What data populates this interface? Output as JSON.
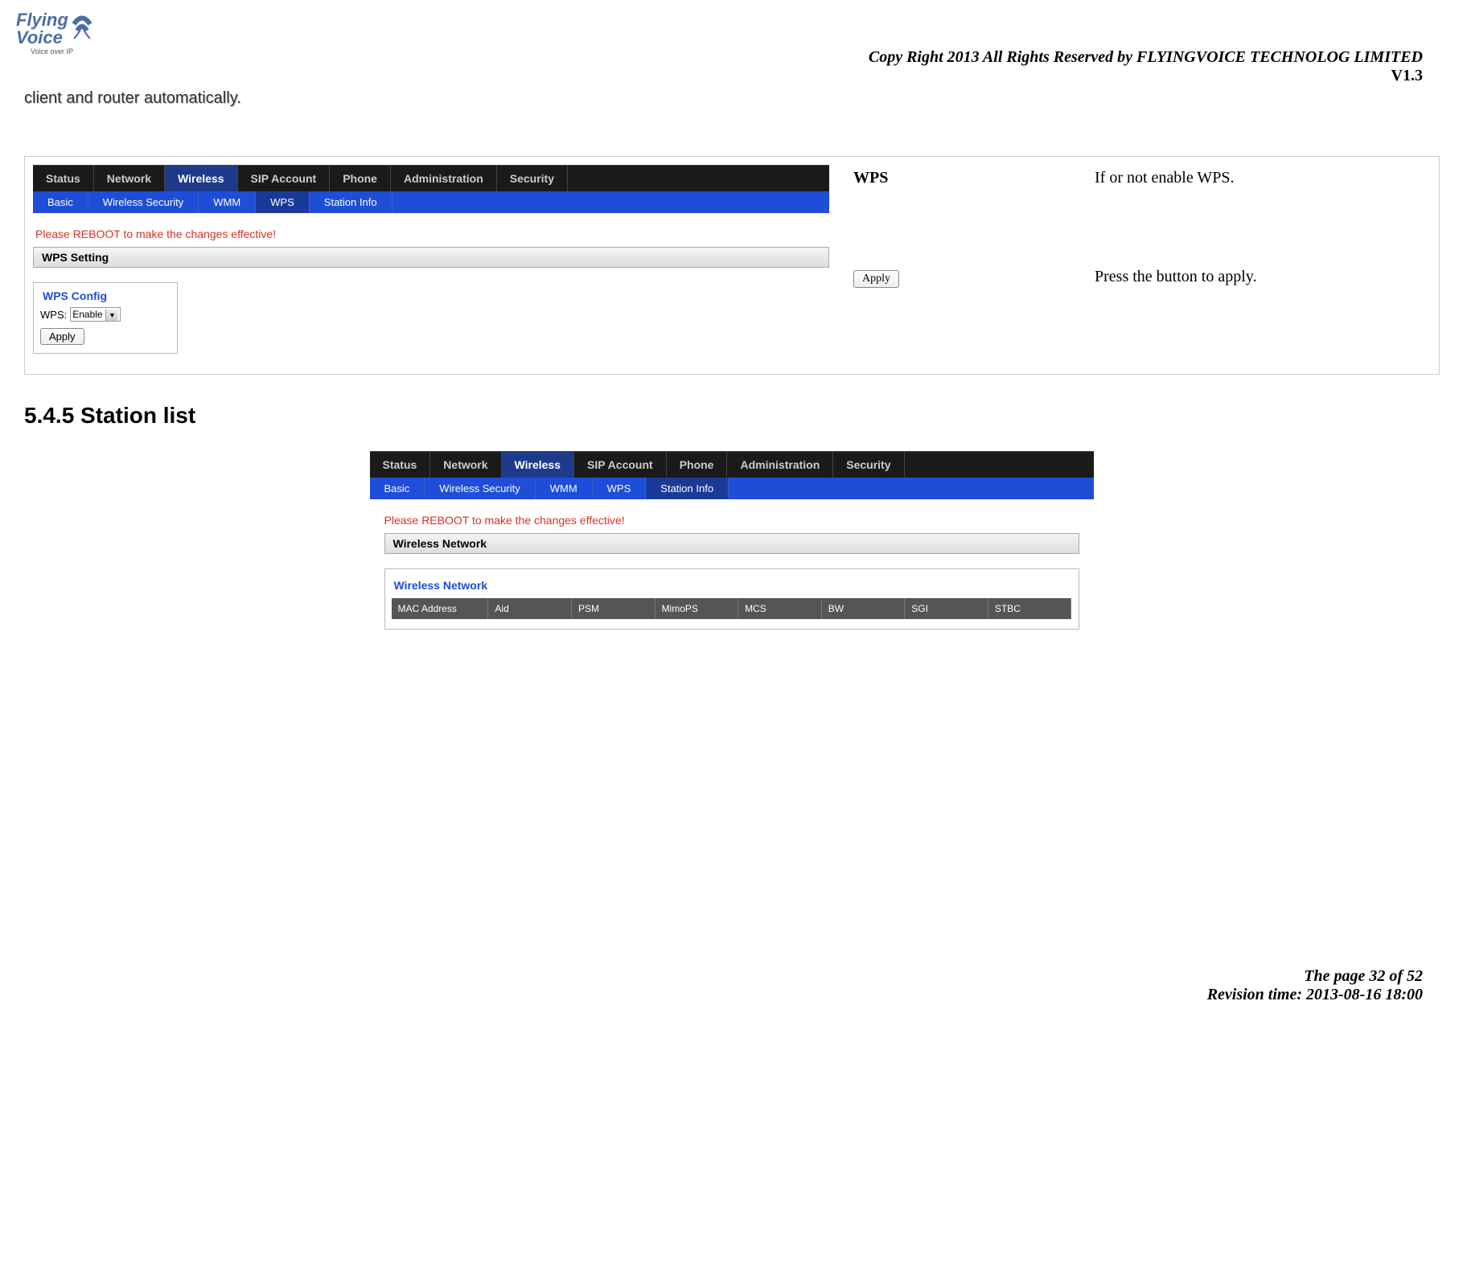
{
  "header": {
    "copyright": "Copy Right 2013 All Rights Reserved by FLYINGVOICE TECHNOLOG LIMITED",
    "version": "V1.3",
    "intro": "client and router automatically."
  },
  "logo": {
    "line1": "Flying",
    "line2": "Voice",
    "tagline": "Voice over IP"
  },
  "desc_table": {
    "row1_label": "WPS",
    "row1_text": "If or not enable WPS.",
    "row2_button": "Apply",
    "row2_text": "Press the button to apply."
  },
  "router1": {
    "nav": [
      "Status",
      "Network",
      "Wireless",
      "SIP Account",
      "Phone",
      "Administration",
      "Security"
    ],
    "nav_active": "Wireless",
    "subnav": [
      "Basic",
      "Wireless Security",
      "WMM",
      "WPS",
      "Station Info"
    ],
    "subnav_active": "WPS",
    "reboot": "Please REBOOT to make the changes effective!",
    "section": "WPS Setting",
    "fieldset": "WPS Config",
    "wps_label": "WPS:",
    "wps_value": "Enable",
    "apply": "Apply"
  },
  "section_heading": "5.4.5 Station list",
  "router2": {
    "nav": [
      "Status",
      "Network",
      "Wireless",
      "SIP Account",
      "Phone",
      "Administration",
      "Security"
    ],
    "nav_active": "Wireless",
    "subnav": [
      "Basic",
      "Wireless Security",
      "WMM",
      "WPS",
      "Station Info"
    ],
    "subnav_active": "Station Info",
    "reboot": "Please REBOOT to make the changes effective!",
    "section": "Wireless Network",
    "fieldset": "Wireless Network",
    "columns": [
      "MAC Address",
      "Aid",
      "PSM",
      "MimoPS",
      "MCS",
      "BW",
      "SGI",
      "STBC"
    ]
  },
  "footer": {
    "page": "The page 32 of 52",
    "revision": "Revision time: 2013-08-16 18:00"
  }
}
